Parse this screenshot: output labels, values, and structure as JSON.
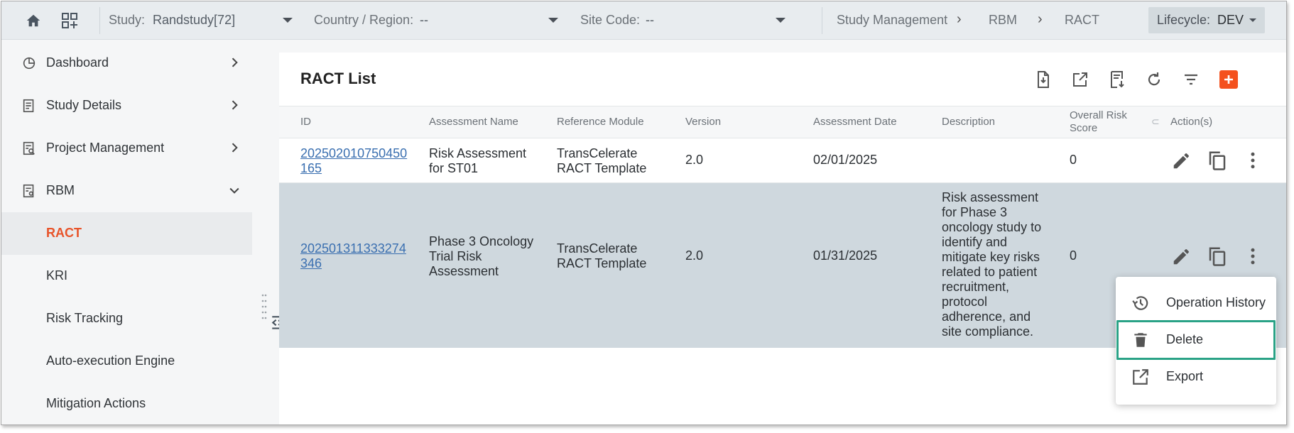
{
  "topbar": {
    "study_label": "Study:",
    "study_value": "Randstudy[72]",
    "country_label": "Country / Region:",
    "country_value": "--",
    "site_label": "Site Code:",
    "site_value": "--",
    "breadcrumb": [
      "Study Management",
      "RBM",
      "RACT"
    ],
    "lifecycle_label": "Lifecycle:",
    "lifecycle_value": "DEV"
  },
  "sidebar": {
    "items": [
      {
        "label": "Dashboard",
        "icon": "pie-chart-icon",
        "expand": "chevron-right"
      },
      {
        "label": "Study Details",
        "icon": "document-icon",
        "expand": "chevron-right"
      },
      {
        "label": "Project Management",
        "icon": "document-search-icon",
        "expand": "chevron-right"
      },
      {
        "label": "RBM",
        "icon": "document-gear-icon",
        "expand": "chevron-down"
      },
      {
        "label": "RACT",
        "active": true
      },
      {
        "label": "KRI"
      },
      {
        "label": "Risk Tracking"
      },
      {
        "label": "Auto-execution Engine"
      },
      {
        "label": "Mitigation Actions"
      }
    ]
  },
  "main": {
    "title": "RACT List",
    "toolbar_icons": [
      "import-icon",
      "open-external-icon",
      "download-list-icon",
      "refresh-icon",
      "filter-icon",
      "add-icon"
    ],
    "columns": [
      "ID",
      "Assessment Name",
      "Reference Module",
      "Version",
      "Assessment Date",
      "Description",
      "Overall Risk Score",
      "Action(s)"
    ],
    "rows": [
      {
        "id_line1": "202502010750450",
        "id_line2": "165",
        "name": [
          "Risk Assessment",
          "for ST01"
        ],
        "module": [
          "TransCelerate",
          "RACT Template"
        ],
        "version": "2.0",
        "date": "02/01/2025",
        "description": [],
        "score": "0"
      },
      {
        "id_line1": "202501311333274",
        "id_line2": "346",
        "name": [
          "Phase 3 Oncology",
          "Trial Risk",
          "Assessment"
        ],
        "module": [
          "TransCelerate",
          "RACT Template"
        ],
        "version": "2.0",
        "date": "01/31/2025",
        "description": [
          "Risk assessment",
          "for Phase 3",
          "oncology study to",
          "identify and",
          "mitigate key risks",
          "related to patient",
          "recruitment,",
          "protocol",
          "adherence, and",
          "site compliance."
        ],
        "score": "0"
      }
    ]
  },
  "menu": {
    "items": [
      {
        "label": "Operation History",
        "icon": "history-icon"
      },
      {
        "label": "Delete",
        "icon": "trash-icon",
        "highlighted": true
      },
      {
        "label": "Export",
        "icon": "export-icon"
      }
    ]
  },
  "colors": {
    "accent": "#e8542a",
    "add_button": "#f4511e",
    "link": "#3a6fb0",
    "selected_row": "#cfd8de",
    "highlight_outline": "#2aa286"
  }
}
